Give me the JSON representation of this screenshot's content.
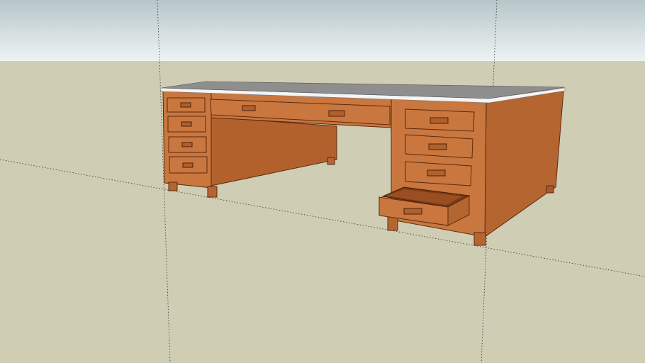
{
  "scene": {
    "model": "desk",
    "colors": {
      "sky_top": "#b6c6c9",
      "sky_horizon": "#eef3f3",
      "ground": "#cfcdb3",
      "wood_front": "#c9773e",
      "wood_side": "#b5652f",
      "wood_shadow": "#a9582a",
      "desk_top": "#8e8e8e",
      "edge": "#5a2a10"
    },
    "icons": {
      "axis": "dotted-axis-line"
    }
  }
}
